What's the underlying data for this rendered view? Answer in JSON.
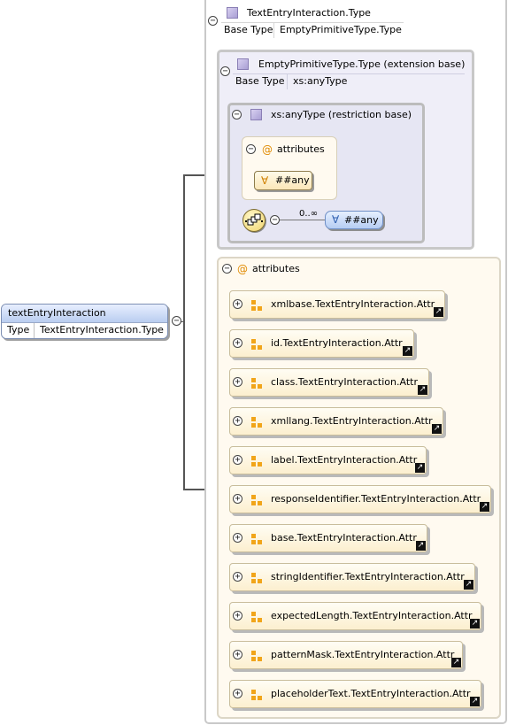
{
  "element": {
    "name": "textEntryInteraction",
    "type_key": "Type",
    "type_value": "TextEntryInteraction.Type"
  },
  "complex_type": {
    "name": "TextEntryInteraction.Type",
    "base_key": "Base Type",
    "base_value": "EmptyPrimitiveType.Type"
  },
  "extension": {
    "name": "EmptyPrimitiveType.Type (extension base)",
    "base_key": "Base Type",
    "base_value": "xs:anyType"
  },
  "restriction": {
    "name": "xs:anyType (restriction base)",
    "attributes_label": "attributes",
    "any_attribute": "##any",
    "occurs": "0..∞",
    "any_element": "##any"
  },
  "attributes": {
    "label": "attributes",
    "items": [
      "xmlbase.TextEntryInteraction.Attr",
      "id.TextEntryInteraction.Attr",
      "class.TextEntryInteraction.Attr",
      "xmllang.TextEntryInteraction.Attr",
      "label.TextEntryInteraction.Attr",
      "responseIdentifier.TextEntryInteraction.Attr",
      "base.TextEntryInteraction.Attr",
      "stringIdentifier.TextEntryInteraction.Attr",
      "expectedLength.TextEntryInteraction.Attr",
      "patternMask.TextEntryInteraction.Attr",
      "placeholderText.TextEntryInteraction.Attr"
    ]
  },
  "icons": {
    "collapse": "minus-circle-icon",
    "expand": "plus-circle-icon",
    "attribute": "at-sign-icon",
    "attribute-ref": "attribute-group-icon",
    "type": "complex-type-icon",
    "link": "arrow-link-icon",
    "sequence": "sequence-compositor-icon",
    "wildcard": "forall-icon"
  },
  "colors": {
    "attribute_fill": "#fcefcf",
    "any_element_fill": "#b6cdf3",
    "type_icon": "#a99fd4",
    "attribute_icon": "#f1a51a"
  }
}
